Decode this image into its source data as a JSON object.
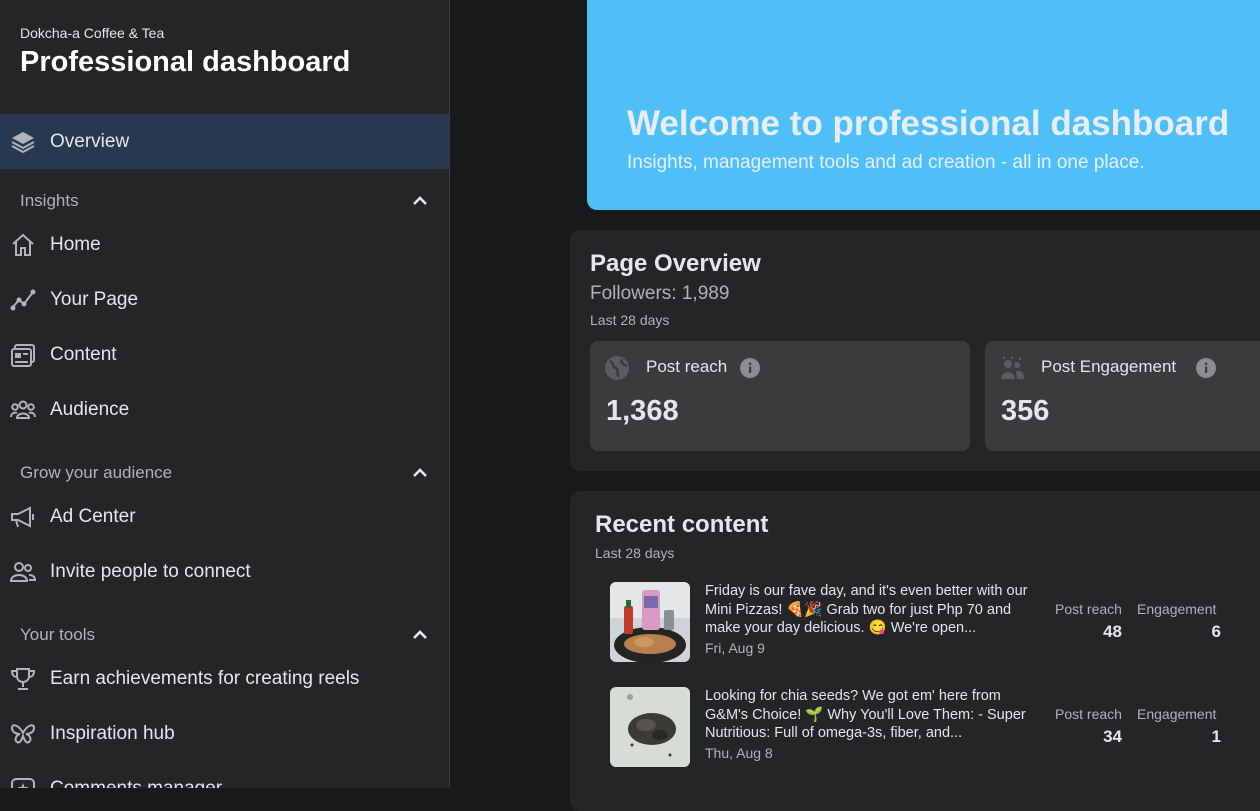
{
  "sidebar": {
    "page_name": "Dokcha-a Coffee & Tea",
    "title": "Professional dashboard",
    "overview": {
      "label": "Overview",
      "icon": "layers-icon"
    },
    "sections": [
      {
        "label": "Insights",
        "items": [
          {
            "label": "Home",
            "icon": "home-icon"
          },
          {
            "label": "Your Page",
            "icon": "trend-icon"
          },
          {
            "label": "Content",
            "icon": "content-icon"
          },
          {
            "label": "Audience",
            "icon": "audience-icon"
          }
        ]
      },
      {
        "label": "Grow your audience",
        "items": [
          {
            "label": "Ad Center",
            "icon": "megaphone-icon"
          },
          {
            "label": "Invite people to connect",
            "icon": "people-icon"
          }
        ]
      },
      {
        "label": "Your tools",
        "items": [
          {
            "label": "Earn achievements for creating reels",
            "icon": "trophy-icon"
          },
          {
            "label": "Inspiration hub",
            "icon": "butterfly-icon"
          },
          {
            "label": "Comments manager",
            "icon": "comments-icon"
          }
        ]
      }
    ]
  },
  "banner": {
    "title": "Welcome to professional dashboard",
    "subtitle": "Insights, management tools and ad creation - all in one place.",
    "color": "#4fbff7"
  },
  "overview": {
    "title": "Page Overview",
    "followers": "Followers: 1,989",
    "range": "Last 28 days",
    "metrics": [
      {
        "label": "Post reach",
        "value": "1,368",
        "icon": "globe-icon"
      },
      {
        "label": "Post Engagement",
        "value": "356",
        "icon": "people-icon"
      }
    ]
  },
  "recent": {
    "title": "Recent content",
    "range": "Last 28 days",
    "posts": [
      {
        "text": "Friday is our fave day, and it's even better with our Mini Pizzas! 🍕🎉 Grab two for just Php 70 and make your day delicious. 😋 We're open...",
        "date": "Fri, Aug 9",
        "reach_label": "Post reach",
        "reach": "48",
        "engagement_label": "Engagement",
        "engagement": "6"
      },
      {
        "text": "Looking for chia seeds? We got em' here from G&M's Choice! 🌱 Why You'll Love Them: - Super Nutritious: Full of omega-3s, fiber, and...",
        "date": "Thu, Aug 8",
        "reach_label": "Post reach",
        "reach": "34",
        "engagement_label": "Engagement",
        "engagement": "1"
      }
    ]
  }
}
